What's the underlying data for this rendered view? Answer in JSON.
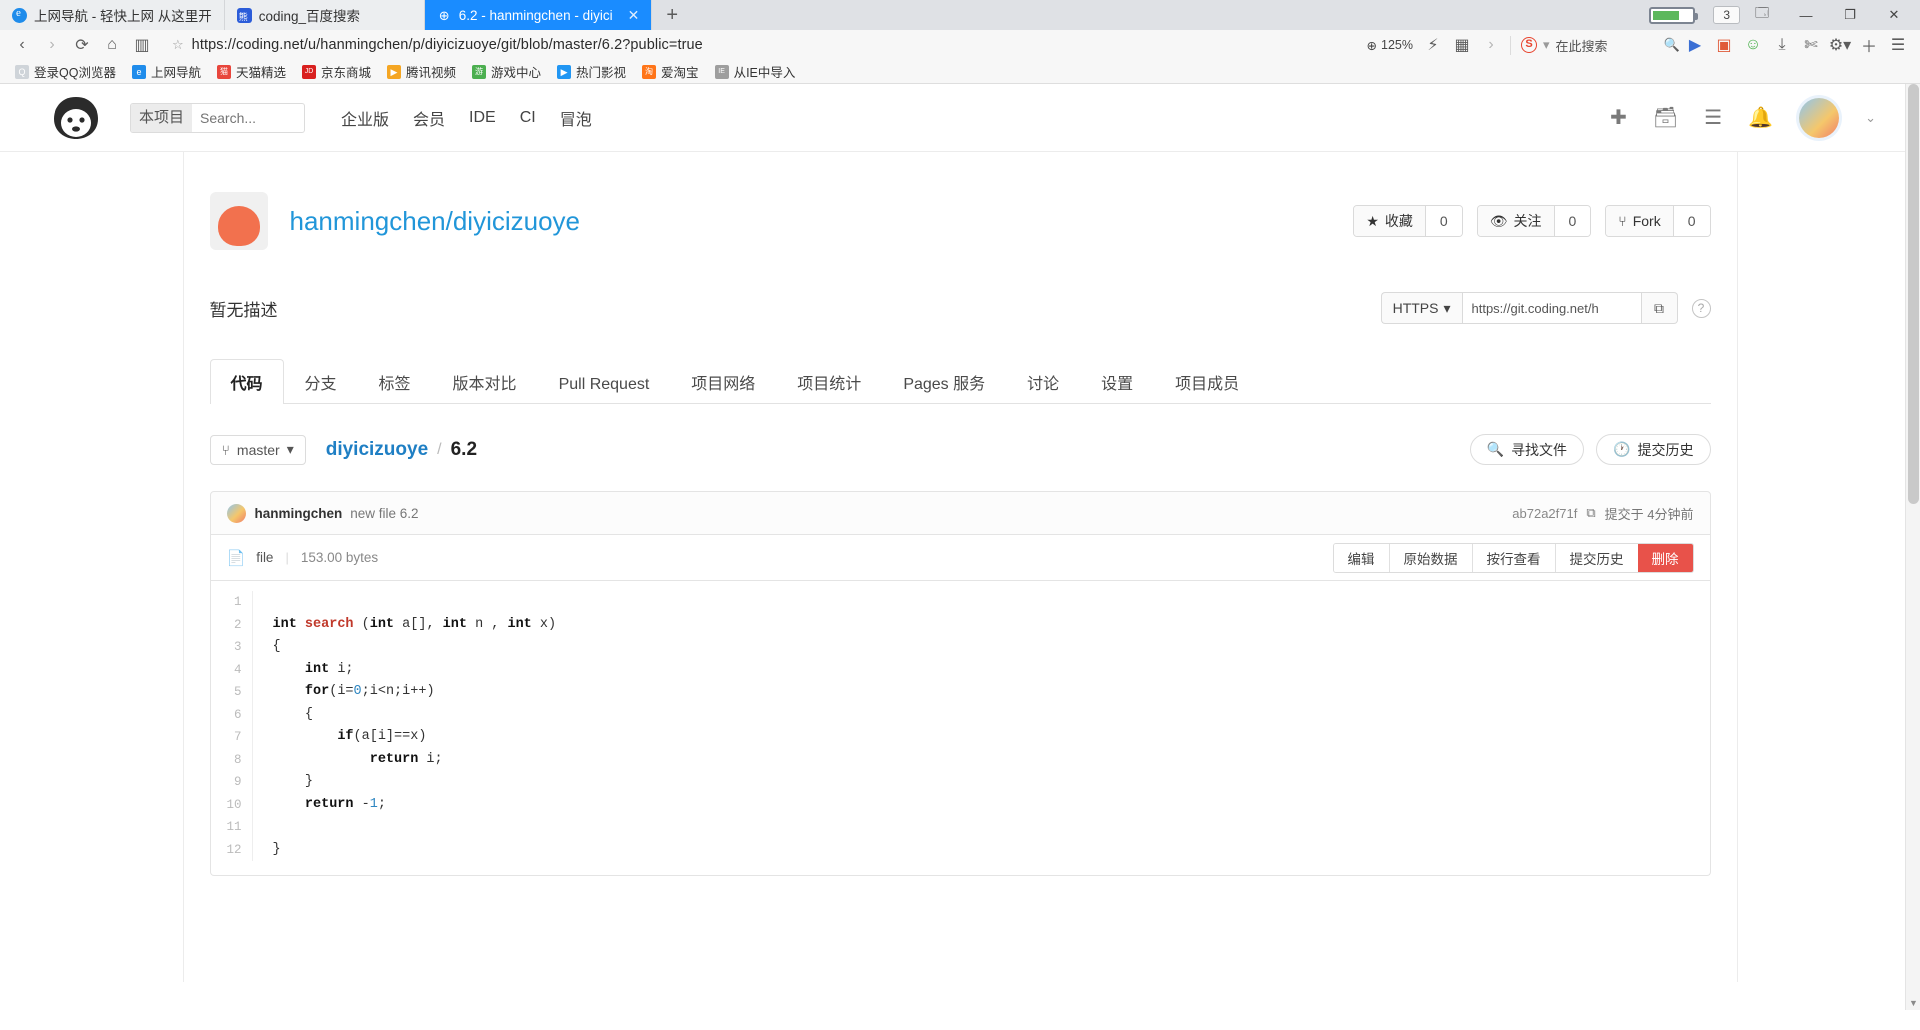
{
  "browser": {
    "tabs": [
      {
        "title": "上网导航 - 轻快上网 从这里开",
        "icon": "edge-icon",
        "active": false
      },
      {
        "title": "coding_百度搜索",
        "icon": "baidu-icon",
        "active": false
      },
      {
        "title": "6.2 - hanmingchen - diyici",
        "icon": "globe-icon",
        "active": true
      }
    ],
    "new_tab_label": "+",
    "notification_count": "3",
    "window_controls": {
      "minimize": "—",
      "maximize": "❐",
      "close": "✕"
    },
    "url": "https://coding.net/u/hanmingchen/p/diyicizuoye/git/blob/master/6.2?public=true",
    "zoom_level": "125%",
    "search_placeholder": "在此搜索",
    "bookmarks": [
      {
        "label": "登录QQ浏览器",
        "color": "#cfd4d9",
        "glyph": "Q"
      },
      {
        "label": "上网导航",
        "color": "#1f8ceb",
        "glyph": "e"
      },
      {
        "label": "天猫精选",
        "color": "#e8463c",
        "glyph": "猫"
      },
      {
        "label": "京东商城",
        "color": "#d9201f",
        "glyph": "JD"
      },
      {
        "label": "腾讯视频",
        "color": "#f5a623",
        "glyph": "▶"
      },
      {
        "label": "游戏中心",
        "color": "#4caf50",
        "glyph": "游"
      },
      {
        "label": "热门影视",
        "color": "#2196f3",
        "glyph": "▶"
      },
      {
        "label": "爱淘宝",
        "color": "#ff7519",
        "glyph": "淘"
      },
      {
        "label": "从IE中导入",
        "color": "#9e9e9e",
        "glyph": "IE"
      }
    ]
  },
  "site": {
    "logo_name": "coding-monkey-logo",
    "search": {
      "scope": "本项目",
      "placeholder": "Search..."
    },
    "nav": [
      "企业版",
      "会员",
      "IDE",
      "CI",
      "冒泡"
    ],
    "right_icons": [
      "plus-icon",
      "archive-icon",
      "list-icon",
      "bell-icon"
    ]
  },
  "repo": {
    "title": "hanmingchen/diyicizuoye",
    "description": "暂无描述",
    "stats": [
      {
        "label": "收藏",
        "icon": "star-icon",
        "count": "0"
      },
      {
        "label": "关注",
        "icon": "eye-icon",
        "count": "0"
      },
      {
        "label": "Fork",
        "icon": "fork-icon",
        "count": "0"
      }
    ],
    "clone": {
      "protocol": "HTTPS",
      "url": "https://git.coding.net/h",
      "copy_icon": "copy-icon",
      "help_icon": "question-icon"
    },
    "tabs": [
      {
        "label": "代码",
        "active": true
      },
      {
        "label": "分支",
        "active": false
      },
      {
        "label": "标签",
        "active": false
      },
      {
        "label": "版本对比",
        "active": false
      },
      {
        "label": "Pull Request",
        "active": false
      },
      {
        "label": "项目网络",
        "active": false
      },
      {
        "label": "项目统计",
        "active": false
      },
      {
        "label": "Pages 服务",
        "active": false
      },
      {
        "label": "讨论",
        "active": false
      },
      {
        "label": "设置",
        "active": false
      },
      {
        "label": "项目成员",
        "active": false
      }
    ]
  },
  "filebar": {
    "branch": "master",
    "breadcrumb_repo": "diyicizuoye",
    "breadcrumb_sep": "/",
    "breadcrumb_file": "6.2",
    "find_file": "寻找文件",
    "commit_history": "提交历史"
  },
  "commit": {
    "author": "hanmingchen",
    "message": "new file 6.2",
    "sha": "ab72a2f71f",
    "copy_icon": "copy-icon",
    "time": "提交于 4分钟前"
  },
  "file": {
    "name": "file",
    "size": "153.00 bytes",
    "actions": [
      {
        "label": "编辑",
        "danger": false
      },
      {
        "label": "原始数据",
        "danger": false
      },
      {
        "label": "按行查看",
        "danger": false
      },
      {
        "label": "提交历史",
        "danger": false
      },
      {
        "label": "删除",
        "danger": true
      }
    ],
    "line_numbers": [
      "1",
      "2",
      "3",
      "4",
      "5",
      "6",
      "7",
      "8",
      "9",
      "10",
      "11",
      "12"
    ],
    "code_lines": [
      "",
      "int search (int a[], int n , int x)",
      "{",
      "    int i;",
      "    for(i=0;i<n;i++)",
      "    {",
      "        if(a[i]==x)",
      "            return i;",
      "    }",
      "    return -1;",
      "",
      "}"
    ]
  }
}
